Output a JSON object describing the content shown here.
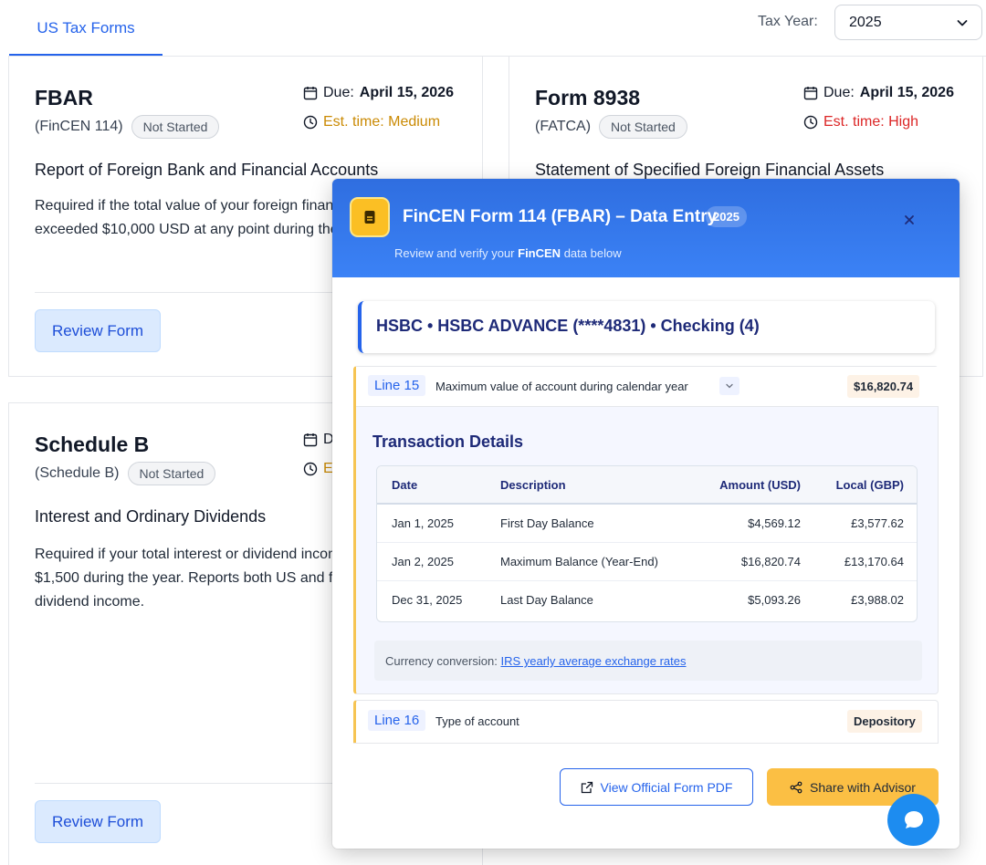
{
  "tabs": {
    "active_tab": "US Tax Forms"
  },
  "tax_year": {
    "label": "Tax Year:",
    "selected": "2025"
  },
  "cards": [
    {
      "title": "FBAR",
      "subtitle": "(FinCEN 114)",
      "status": "Not Started",
      "due_prefix": "Due:",
      "due_date": "April 15, 2026",
      "est_time": "Est. time: Medium",
      "heading": "Report of Foreign Bank and Financial Accounts",
      "description": "Required if the total value of your foreign financial accounts exceeded $10,000 USD at any point during the year.",
      "button": "Review Form"
    },
    {
      "title": "Form 8938",
      "subtitle": "(FATCA)",
      "status": "Not Started",
      "due_prefix": "Due:",
      "due_date": "April 15, 2026",
      "est_time": "Est. time: High",
      "heading": "Statement of Specified Foreign Financial Assets"
    },
    {
      "title": "Schedule B",
      "subtitle": "(Schedule B)",
      "status": "Not Started",
      "due_prefix": "D",
      "est_time": "E",
      "heading": "Interest and Ordinary Dividends",
      "description": "Required if your total interest or dividend income exceeded $1,500 during the year. Reports both US and foreign interest and dividend income.",
      "button": "Review Form"
    }
  ],
  "modal": {
    "title": "FinCEN Form 114 (FBAR) – Data Entry",
    "year": "2025",
    "subtitle_prefix": "Review and verify your",
    "subtitle_bold": "FinCEN",
    "subtitle_suffix": "data below",
    "account": "HSBC • HSBC ADVANCE (****4831) • Checking (4)",
    "line15": {
      "tag": "Line 15",
      "label": "Maximum value of account during calendar year",
      "value": "$16,820.74"
    },
    "transactions": {
      "heading": "Transaction Details",
      "columns": [
        "Date",
        "Description",
        "Amount (USD)",
        "Local (GBP)"
      ],
      "rows": [
        {
          "date": "Jan 1, 2025",
          "description": "First Day Balance",
          "usd": "$4,569.12",
          "gbp": "£3,577.62"
        },
        {
          "date": "Jan 2, 2025",
          "description": "Maximum Balance (Year-End)",
          "usd": "$16,820.74",
          "gbp": "£13,170.64"
        },
        {
          "date": "Dec 31, 2025",
          "description": "Last Day Balance",
          "usd": "$5,093.26",
          "gbp": "£3,988.02"
        }
      ]
    },
    "conversion": {
      "prefix": "Currency conversion:",
      "link": "IRS yearly average exchange rates"
    },
    "line16": {
      "tag": "Line 16",
      "label": "Type of account",
      "value": "Depository"
    },
    "buttons": {
      "pdf": "View Official Form PDF",
      "share": "Share with Advisor"
    }
  },
  "colors": {
    "primary": "#2563eb",
    "accent": "#fbbf24",
    "medium": "#ca8a04",
    "high": "#dc2626"
  }
}
